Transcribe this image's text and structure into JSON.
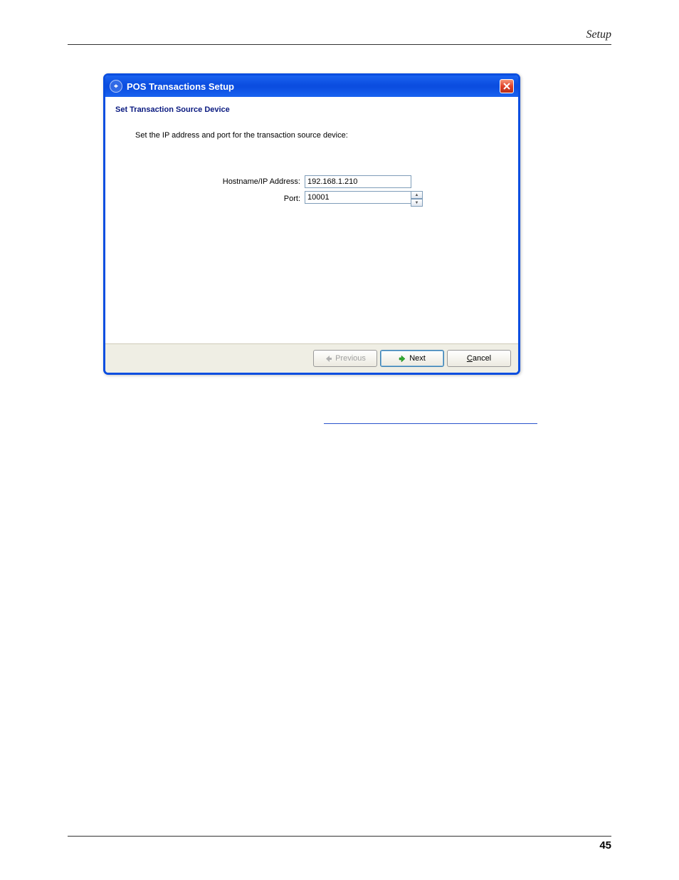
{
  "page": {
    "header": "Setup",
    "footer_page": "45"
  },
  "dialog": {
    "title": "POS Transactions Setup",
    "step_title": "Set Transaction Source Device",
    "instruction": "Set the IP address and port for the transaction source device:",
    "fields": {
      "hostname_label": "Hostname/IP Address:",
      "hostname_value": "192.168.1.210",
      "port_label": "Port:",
      "port_value": "10001"
    },
    "buttons": {
      "previous": "Previous",
      "next": "Next",
      "cancel": "Cancel"
    }
  }
}
